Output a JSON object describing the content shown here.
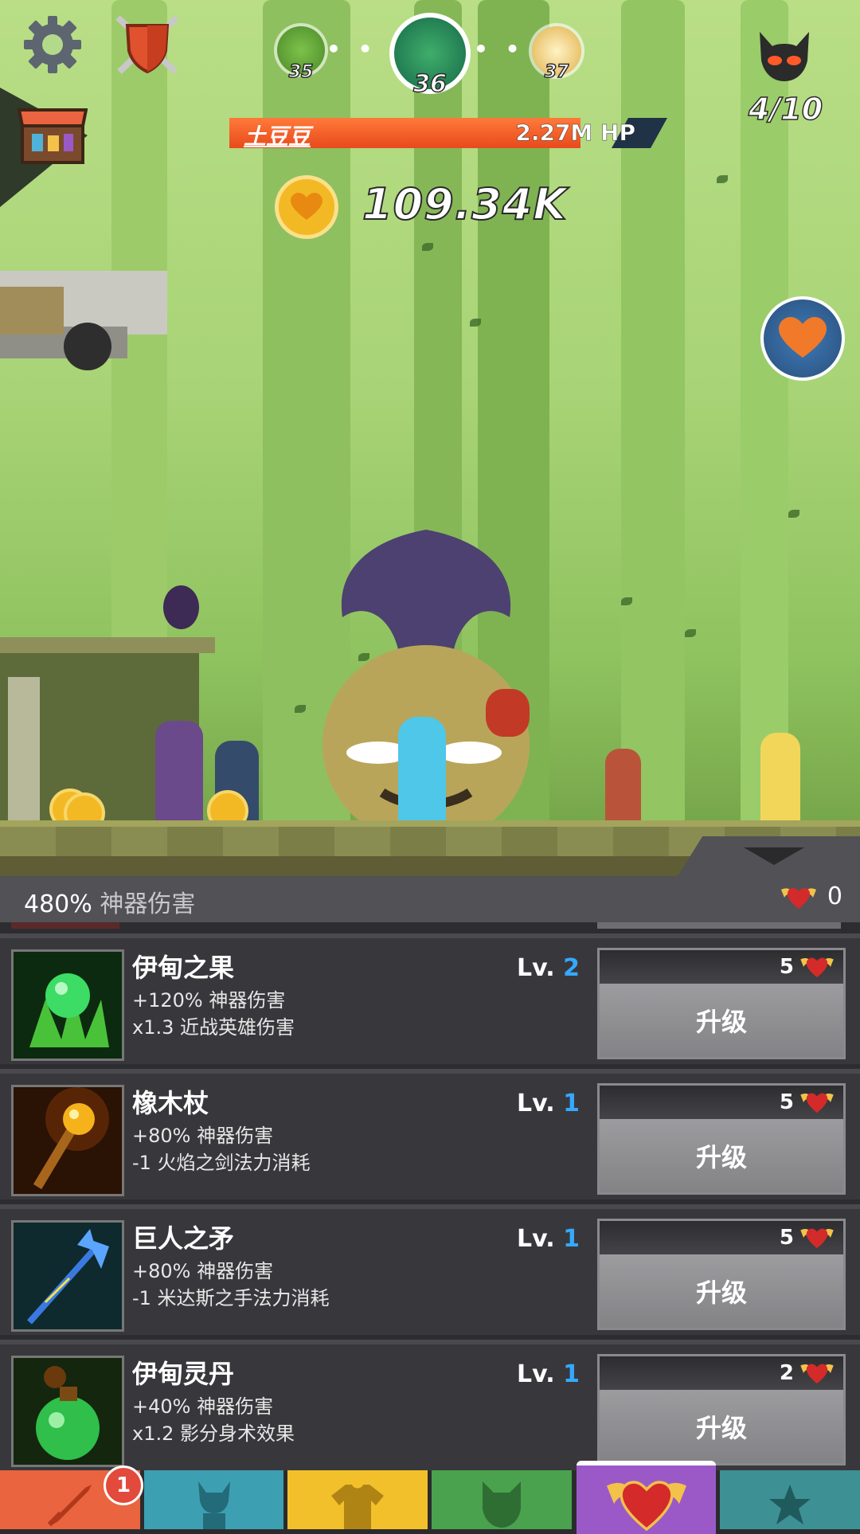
{
  "hud": {
    "stages": [
      {
        "num": "35"
      },
      {
        "num": "36"
      },
      {
        "num": "37"
      }
    ],
    "boss": {
      "name": "土豆豆",
      "hp": "2.27M HP",
      "hp_fraction": 0.9
    },
    "gold": "109.34K",
    "boss_count": "4/10"
  },
  "strip": {
    "artifact_damage_value": "480%",
    "artifact_damage_label": "神器伤害",
    "relic_count": "0"
  },
  "artifacts": [
    {
      "name": "伊甸之果",
      "line1": "+120% 神器伤害",
      "line2": "x1.3 近战英雄伤害",
      "lv_prefix": "Lv.",
      "lv": "2",
      "cost": "5",
      "button": "升级",
      "color": "#2a7d2a"
    },
    {
      "name": "橡木杖",
      "line1": "+80% 神器伤害",
      "line2": "-1 火焰之剑法力消耗",
      "lv_prefix": "Lv.",
      "lv": "1",
      "cost": "5",
      "button": "升级",
      "color": "#8a4a10"
    },
    {
      "name": "巨人之矛",
      "line1": "+80% 神器伤害",
      "line2": "-1 米达斯之手法力消耗",
      "lv_prefix": "Lv.",
      "lv": "1",
      "cost": "5",
      "button": "升级",
      "color": "#1d4d5a"
    },
    {
      "name": "伊甸灵丹",
      "line1": "+40% 神器伤害",
      "line2": "x1.2 影分身术效果",
      "lv_prefix": "Lv.",
      "lv": "1",
      "cost": "2",
      "button": "升级",
      "color": "#2a5a24"
    }
  ],
  "tabs": {
    "badge": "1",
    "items": [
      {
        "icon": "sword-icon",
        "color": "#e9643f"
      },
      {
        "icon": "hero-icon",
        "color": "#3d9fb2"
      },
      {
        "icon": "shirt-icon",
        "color": "#f2c02a"
      },
      {
        "icon": "pet-icon",
        "color": "#4aa24e"
      },
      {
        "icon": "artifact-heart-icon",
        "color": "#9b59c8"
      },
      {
        "icon": "star-icon",
        "color": "#3d9094"
      }
    ]
  },
  "colors": {
    "accent_blue": "#35a9ff",
    "hp_orange": "#ee5522"
  }
}
